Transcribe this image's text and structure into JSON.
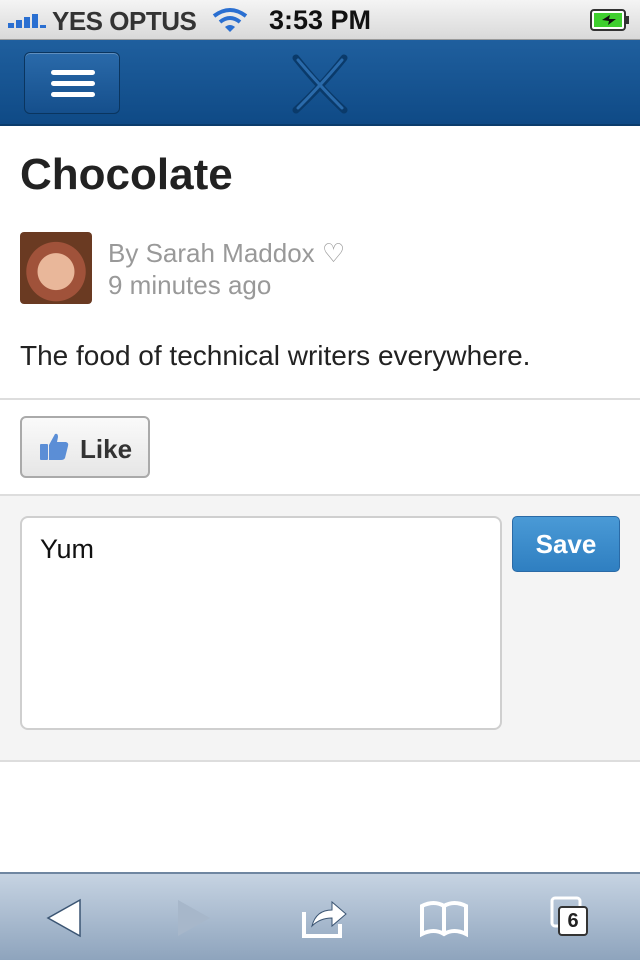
{
  "status_bar": {
    "carrier": "YES OPTUS",
    "time": "3:53 PM"
  },
  "navbar": {
    "menu_icon": "hamburger-icon",
    "logo_icon": "confluence-logo-icon"
  },
  "post": {
    "title": "Chocolate",
    "author_line": "By Sarah Maddox ♡",
    "time_ago": "9 minutes ago",
    "body": "The food of technical writers everywhere."
  },
  "actions": {
    "like_label": "Like"
  },
  "comment": {
    "value": "Yum",
    "save_label": "Save"
  },
  "browser_toolbar": {
    "tabs_count": "6"
  },
  "colors": {
    "navbar": "#15528f",
    "save_button": "#3a8acb",
    "status_signal": "#2a6fd1",
    "battery": "#3fcf2f"
  }
}
